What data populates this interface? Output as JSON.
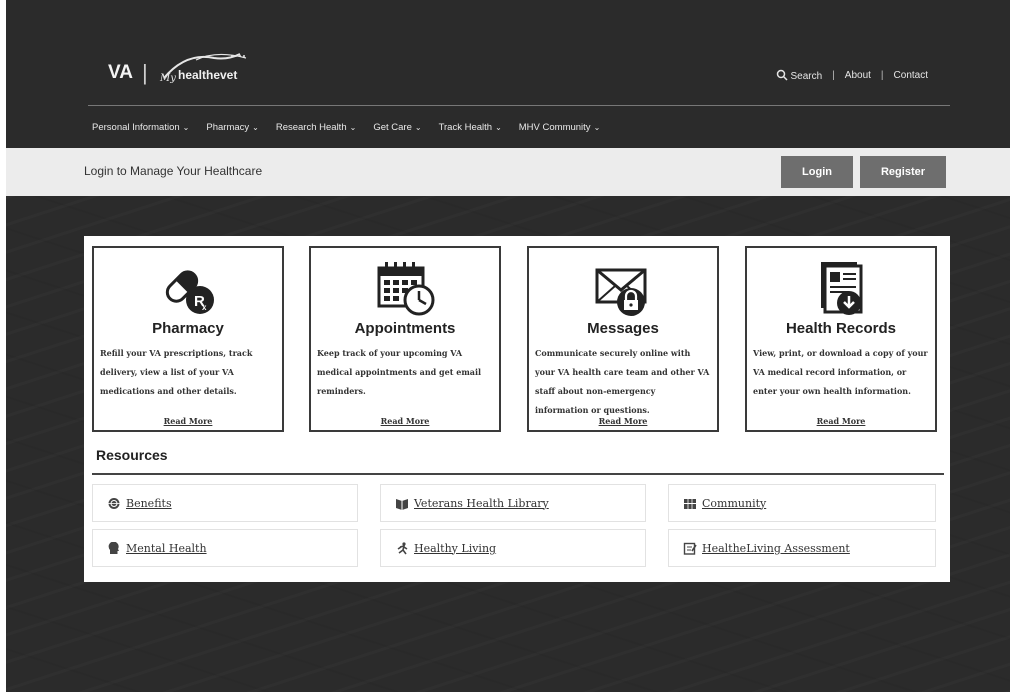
{
  "header": {
    "logo_va": "VA",
    "logo_sep": "|",
    "logo_mhv": "My healthevet",
    "top_links": {
      "search": "Search",
      "about": "About",
      "contact": "Contact",
      "divider": "|"
    }
  },
  "nav": [
    {
      "label": "Personal Information",
      "chevron": "⌄"
    },
    {
      "label": "Pharmacy",
      "chevron": "⌄"
    },
    {
      "label": "Research Health",
      "chevron": "⌄"
    },
    {
      "label": "Get Care",
      "chevron": "⌄"
    },
    {
      "label": "Track Health",
      "chevron": "⌄"
    },
    {
      "label": "MHV Community",
      "chevron": "⌄"
    }
  ],
  "login_band": {
    "text": "Login to Manage Your Healthcare",
    "login": "Login",
    "register": "Register"
  },
  "cards": [
    {
      "icon": "pill-rx-icon",
      "title": "Pharmacy",
      "desc": "Refill your VA prescriptions, track delivery, view a list of your VA medications and other details.",
      "more": "Read More"
    },
    {
      "icon": "calendar-clock-icon",
      "title": "Appointments",
      "desc": "Keep track of your upcoming VA medical appointments and get email reminders.",
      "more": "Read More"
    },
    {
      "icon": "envelope-lock-icon",
      "title": "Messages",
      "desc": "Communicate securely online with your VA health care team and other VA staff about non-emergency information or questions.",
      "more": "Read More"
    },
    {
      "icon": "records-download-icon",
      "title": "Health Records",
      "desc": "View, print, or download a copy of your VA medical record information, or enter your own health information.",
      "more": "Read More"
    }
  ],
  "resources": {
    "title": "Resources",
    "items": [
      {
        "icon": "globe-icon",
        "label": "Benefits"
      },
      {
        "icon": "book-icon",
        "label": "Veterans Health Library"
      },
      {
        "icon": "people-icon",
        "label": "Community"
      },
      {
        "icon": "head-icon",
        "label": "Mental Health"
      },
      {
        "icon": "running-icon",
        "label": "Healthy Living"
      },
      {
        "icon": "clipboard-icon",
        "label": "HealtheLiving Assessment"
      }
    ]
  }
}
